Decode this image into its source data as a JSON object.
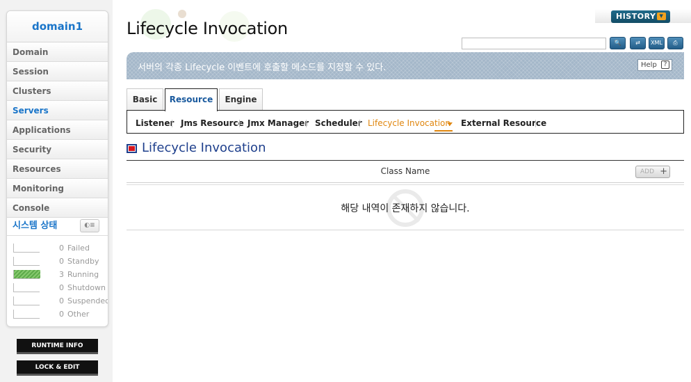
{
  "sidebar": {
    "domain_name": "domain1",
    "nav": [
      {
        "label": "Domain"
      },
      {
        "label": "Session"
      },
      {
        "label": "Clusters"
      },
      {
        "label": "Servers"
      },
      {
        "label": "Applications"
      },
      {
        "label": "Security"
      },
      {
        "label": "Resources"
      },
      {
        "label": "Monitoring"
      },
      {
        "label": "Console"
      }
    ],
    "active_nav": "Servers",
    "status_title": "시스템 상태",
    "status_toggle_icon": "toggle-icon",
    "status": [
      {
        "label": "Failed",
        "count": "0",
        "fraction": 0
      },
      {
        "label": "Standby",
        "count": "0",
        "fraction": 0
      },
      {
        "label": "Running",
        "count": "3",
        "fraction": 1
      },
      {
        "label": "Shutdown",
        "count": "0",
        "fraction": 0
      },
      {
        "label": "Suspended",
        "count": "0",
        "fraction": 0
      },
      {
        "label": "Other",
        "count": "0",
        "fraction": 0
      }
    ],
    "runtime_info_label": "RUNTIME INFO",
    "lock_edit_label": "LOCK & EDIT"
  },
  "header": {
    "title": "Lifecycle Invocation",
    "history_label": "HISTORY",
    "search": {
      "value": "",
      "placeholder": ""
    },
    "toolbar_icons": [
      "search-icon",
      "refresh-icon",
      "xml-export-icon",
      "print-icon"
    ]
  },
  "banner": {
    "description": "서버의 각종 Lifecycle 이벤트에 호출할 메소드를 지정할 수 있다.",
    "help_label": "Help",
    "help_icon": "?"
  },
  "tabs": [
    {
      "label": "Basic"
    },
    {
      "label": "Resource"
    },
    {
      "label": "Engine"
    }
  ],
  "active_tab": "Resource",
  "subnav": [
    {
      "label": "Listener"
    },
    {
      "label": "Jms Resource"
    },
    {
      "label": "Jmx Manager"
    },
    {
      "label": "Scheduler"
    },
    {
      "label": "Lifecycle Invocation"
    },
    {
      "label": "External Resource"
    }
  ],
  "active_subnav": "Lifecycle Invocation",
  "section": {
    "title": "Lifecycle Invocation",
    "table": {
      "columns": [
        "Class Name"
      ],
      "add_label": "ADD",
      "add_icon": "+",
      "empty_message": "해당 내역이 존재하지 않습니다."
    }
  },
  "colors": {
    "accent_blue": "#1a75c9",
    "active_orange": "#e0860e",
    "banner_bg": "#a4b7c9",
    "running_green": "#5daa4a"
  }
}
